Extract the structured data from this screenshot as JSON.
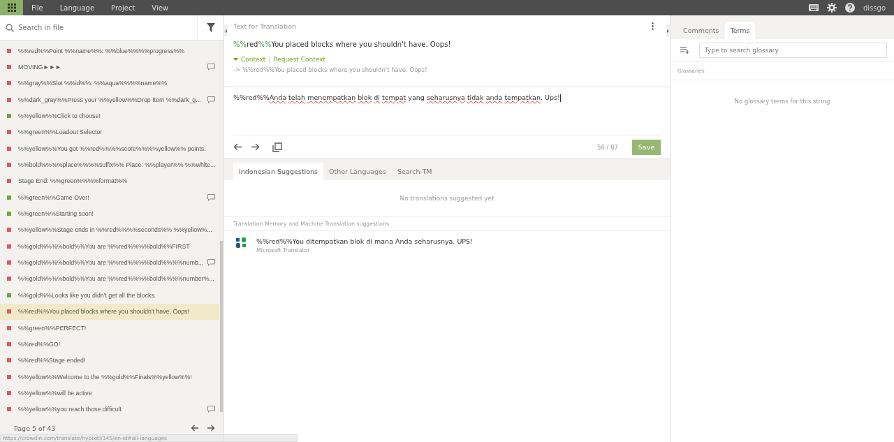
{
  "menu": [
    "File",
    "Language",
    "Project",
    "View"
  ],
  "user": "dissgo",
  "search": {
    "placeholder": "Search in file"
  },
  "strings": [
    {
      "text": "%%red%%Point %%name%%: %%blue%%%%progress%%",
      "color": "#e0595e",
      "comment": false,
      "selected": false
    },
    {
      "text": "MOVING►►►",
      "color": "#e0595e",
      "comment": true,
      "selected": false
    },
    {
      "text": "%%gray%%Slot %%id%%: %%aqua%%%%name%%",
      "color": "#e0595e",
      "comment": false,
      "selected": false
    },
    {
      "text": "%%dark_gray%%Press your %%yellow%%Drop Item %%dark_g...",
      "color": "#e0595e",
      "comment": true,
      "selected": false
    },
    {
      "text": "%%yellow%%Click to choose!",
      "color": "#6fa644",
      "comment": false,
      "selected": false
    },
    {
      "text": "%%green%%Loadout Selector",
      "color": "#e0595e",
      "comment": false,
      "selected": false
    },
    {
      "text": "%%yellow%%You got %%red%%%%score%%%%yellow%% points.",
      "color": "#e0595e",
      "comment": false,
      "selected": false
    },
    {
      "text": "%%bold%%%%place%%%%suffix%% Place: %%player%% %%white...",
      "color": "#e0595e",
      "comment": false,
      "selected": false
    },
    {
      "text": "Stage End: %%green%%%%format%%",
      "color": "#e0595e",
      "comment": false,
      "selected": false
    },
    {
      "text": "%%green%%Game Over!",
      "color": "#6fa644",
      "comment": true,
      "selected": false
    },
    {
      "text": "%%green%%Starting soon!",
      "color": "#6fa644",
      "comment": false,
      "selected": false
    },
    {
      "text": "%%yellow%%Stage ends in %%red%%%%seconds%% %%yellow%...",
      "color": "#e0595e",
      "comment": false,
      "selected": false
    },
    {
      "text": "%%gold%%%%bold%%You are %%red%%%%bold%%FIRST",
      "color": "#e0595e",
      "comment": false,
      "selected": false
    },
    {
      "text": "%%gold%%%%bold%%You are %%red%%%%bold%%%%numb...",
      "color": "#e0595e",
      "comment": true,
      "selected": false
    },
    {
      "text": "%%gold%%%%bold%%You are %%red%%%%bold%%%%number%...",
      "color": "#e0595e",
      "comment": false,
      "selected": false
    },
    {
      "text": "%%gold%%Looks like you didn't get all the blocks.",
      "color": "#6fa644",
      "comment": false,
      "selected": false
    },
    {
      "text": "%%red%%You placed blocks where you shouldn't have. Oops!",
      "color": "#e0595e",
      "comment": false,
      "selected": true
    },
    {
      "text": "%%green%%PERFECT!",
      "color": "#e0595e",
      "comment": false,
      "selected": false
    },
    {
      "text": "%%red%%GO!",
      "color": "#e0595e",
      "comment": false,
      "selected": false
    },
    {
      "text": "%%red%%Stage ended!",
      "color": "#e0595e",
      "comment": false,
      "selected": false
    },
    {
      "text": "%%yellow%%Welcome to the %%gold%%Finals%%yellow%%!",
      "color": "#e0595e",
      "comment": false,
      "selected": false
    },
    {
      "text": "%%yellow%%will be active",
      "color": "#e0595e",
      "comment": false,
      "selected": false
    },
    {
      "text": "%%yellow%%you reach those difficult",
      "color": "#e0595e",
      "comment": true,
      "selected": false
    }
  ],
  "pagination": "Page 5 of 43",
  "status_url": "https://crowdin.com/translate/hypixel/145/en-id#all-languages",
  "source_heading": "Text for Translation",
  "source_text": [
    {
      "kind": "tag",
      "text": "%%"
    },
    {
      "kind": "plain",
      "text": "red"
    },
    {
      "kind": "tag",
      "text": "%%"
    },
    {
      "kind": "plain",
      "text": "You placed blocks where you shouldn't have. Oops!"
    }
  ],
  "context_link": "Context",
  "context_separator": "|",
  "request_context": "Request Context",
  "context_text": "-> %%red%%You placed blocks where you shouldn't have. Oops!",
  "translation": [
    {
      "kind": "plain",
      "text": "%%red%%"
    },
    {
      "kind": "misspelled",
      "text": "Anda "
    },
    {
      "kind": "misspelled",
      "text": "telah "
    },
    {
      "kind": "misspelled",
      "text": "menempatkan "
    },
    {
      "kind": "misspelled",
      "text": "blok "
    },
    {
      "kind": "misspelled",
      "text": "di "
    },
    {
      "kind": "misspelled",
      "text": "tempat "
    },
    {
      "kind": "plain",
      "text": "yang "
    },
    {
      "kind": "misspelled",
      "text": "seharusnya "
    },
    {
      "kind": "misspelled",
      "text": "tidak "
    },
    {
      "kind": "misspelled",
      "text": "anda "
    },
    {
      "kind": "misspelled",
      "text": "tempatkan"
    },
    {
      "kind": "plain",
      "text": ". Ups!"
    }
  ],
  "char_count": "56 / 87",
  "save": "Save",
  "suggestion_tabs": [
    {
      "label": "Indonesian Suggestions",
      "selected": true
    },
    {
      "label": "Other Languages",
      "selected": false
    },
    {
      "label": "Search TM",
      "selected": false
    }
  ],
  "no_suggestions": "No translations suggested yet",
  "tm_heading": "Translation Memory and Machine Translation suggestions",
  "tm_suggestions": [
    {
      "text": "%%red%%You ditempatkan blok di mana Anda seharusnya. UPS!",
      "source": "Microsoft Translator"
    }
  ],
  "side_tabs": [
    {
      "label": "Comments",
      "selected": false
    },
    {
      "label": "Terms",
      "selected": true
    }
  ],
  "glossary_search": {
    "placeholder": "Type to search glossary"
  },
  "glossaries_heading": "Glossaries",
  "no_terms": "No glossary terms for this string"
}
